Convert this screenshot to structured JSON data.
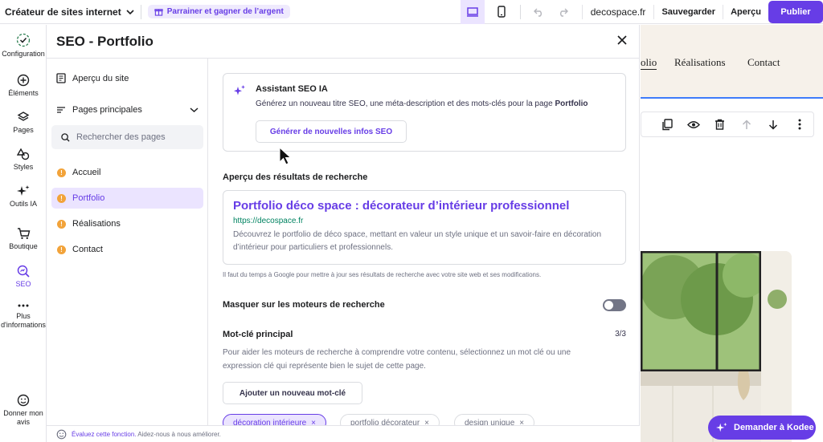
{
  "topbar": {
    "brand": "Créateur de sites internet",
    "referral": "Parrainer et gagner de l’argent",
    "domain": "decospace.fr",
    "save": "Sauvegarder",
    "preview": "Aperçu",
    "publish": "Publier"
  },
  "rail": {
    "configuration": "Configuration",
    "elements": "Éléments",
    "pages": "Pages",
    "styles": "Styles",
    "ai_tools": "Outils IA",
    "shop": "Boutique",
    "seo": "SEO",
    "more_1": "Plus",
    "more_2": "d'informations",
    "feedback_1": "Donner mon",
    "feedback_2": "avis"
  },
  "panel": {
    "title": "SEO - Portfolio",
    "site_overview": "Aperçu du site",
    "main_pages": "Pages principales",
    "search_placeholder": "Rechercher des pages",
    "pages": [
      "Accueil",
      "Portfolio",
      "Réalisations",
      "Contact"
    ],
    "page_status_icon": "!",
    "ai": {
      "title": "Assistant SEO IA",
      "desc_prefix": "Générez un nouveau titre SEO, une méta-description et des mots-clés pour la page ",
      "desc_page": "Portfolio",
      "button": "Générer de nouvelles infos SEO"
    },
    "serp": {
      "label": "Aperçu des résultats de recherche",
      "title": "Portfolio déco space : décorateur d’intérieur professionnel",
      "url": "https://decospace.fr",
      "description": "Découvrez le portfolio de déco space, mettant en valeur un style unique et un savoir-faire en décoration d’intérieur pour particuliers et professionnels.",
      "note": "Il faut du temps à Google pour mettre à jour ses résultats de recherche avec votre site web et ses modifications."
    },
    "hide_label": "Masquer sur les moteurs de recherche",
    "hide_enabled": false,
    "keyword": {
      "label": "Mot-clé principal",
      "count": "3/3",
      "help": "Pour aider les moteurs de recherche à comprendre votre contenu, sélectionnez un mot clé ou une expression clé qui représente bien le sujet de cette page.",
      "add": "Ajouter un nouveau mot-clé",
      "chips": [
        "décoration intérieure",
        "portfolio décorateur",
        "design unique"
      ],
      "chip_remove": "×"
    },
    "footer_link": "Évaluez cette fonction.",
    "footer_text": " Aidez-nous à nous améliorer."
  },
  "preview": {
    "nav": [
      "olio",
      "Réalisations",
      "Contact"
    ],
    "kodee": "Demander à Kodee"
  },
  "colors": {
    "accent": "#673de6",
    "accent_light": "#ebe4ff",
    "warning": "#f2a33a",
    "url_green": "#008361"
  }
}
